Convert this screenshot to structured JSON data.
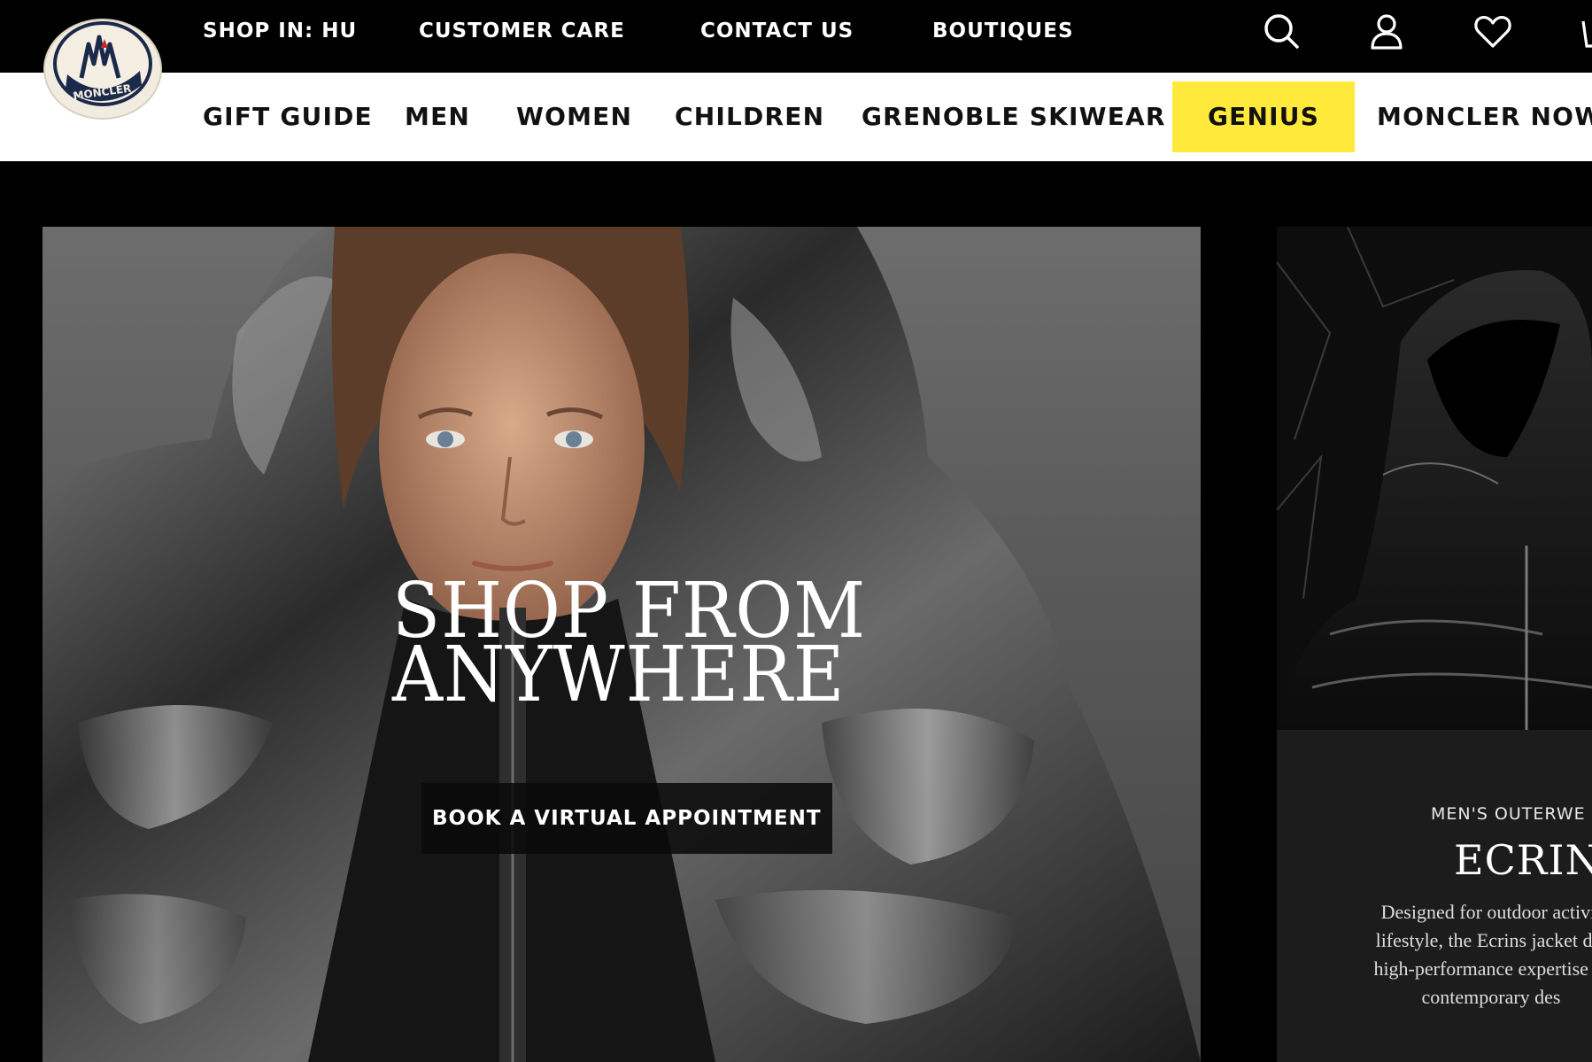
{
  "utility": {
    "shop_in": "SHOP IN: HU",
    "customer_care": "CUSTOMER CARE",
    "contact_us": "CONTACT US",
    "boutiques": "BOUTIQUES",
    "icons": [
      "search-icon",
      "account-icon",
      "wishlist-heart-icon",
      "cart-icon"
    ]
  },
  "logo": {
    "text": "MONCLER"
  },
  "nav": {
    "items": [
      {
        "label": "GIFT GUIDE"
      },
      {
        "label": "MEN"
      },
      {
        "label": "WOMEN"
      },
      {
        "label": "CHILDREN"
      },
      {
        "label": "GRENOBLE SKIWEAR"
      },
      {
        "label": "GENIUS"
      },
      {
        "label": "MONCLER NOW"
      }
    ],
    "highlight_color": "#ffe93b"
  },
  "hero": {
    "title_line1": "SHOP FROM",
    "title_line2": "ANYWHERE",
    "cta": "BOOK A VIRTUAL APPOINTMENT"
  },
  "side_card": {
    "category": "MEN'S OUTERWE",
    "title": "ECRINS",
    "desc_lines": [
      "Designed for outdoor activit",
      "lifestyle, the Ecrins jacket del",
      "high-performance expertise in",
      "contemporary des"
    ]
  }
}
